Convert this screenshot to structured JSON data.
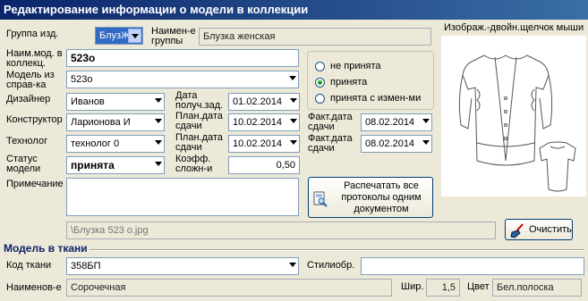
{
  "window": {
    "title": "Редактирование информации о модели в коллекции"
  },
  "group": {
    "label": "Группа изд.",
    "code": "БлузЖен",
    "name_label": "Наимен-е группы",
    "name": "Блузка женская"
  },
  "model_name": {
    "label": "Наим.мод. в коллекц.",
    "value": "523о"
  },
  "model_ref": {
    "label": "Модель из справ-ка",
    "value": "523о"
  },
  "designer": {
    "label": "Дизайнер",
    "value": "Иванов"
  },
  "constructor": {
    "label": "Конструктор",
    "value": "Ларионова И"
  },
  "technologist": {
    "label": "Технолог",
    "value": "технолог 0"
  },
  "status": {
    "label": "Статус модели",
    "value": "принята"
  },
  "date_received": {
    "label": "Дата получ.зад.",
    "value": "01.02.2014"
  },
  "plan_date_1": {
    "label": "План.дата сдачи",
    "value": "10.02.2014"
  },
  "plan_date_2": {
    "label": "План.дата сдачи",
    "value": "10.02.2014"
  },
  "complexity": {
    "label": "Коэфф. сложн-и",
    "value": "0,50"
  },
  "fact_date_1": {
    "label": "Факт.дата сдачи",
    "value": "08.02.2014"
  },
  "fact_date_2": {
    "label": "Факт.дата сдачи",
    "value": "08.02.2014"
  },
  "acceptance": {
    "options": [
      "не принята",
      "принята",
      "принята с измен-ми"
    ],
    "selected": 1
  },
  "note": {
    "label": "Примечание",
    "value": ""
  },
  "print_button": {
    "label": "Распечатать все протоколы одним документом"
  },
  "image": {
    "caption": "Изображ.-двойн.щелчок мыши"
  },
  "image_path": {
    "value": "\\Блузка 523 о.jpg"
  },
  "clear_button": {
    "label": "Очистить"
  },
  "fabric_section": {
    "title": "Модель в ткани",
    "code_label": "Код ткани",
    "code": "358БП",
    "stylist_label": "Стилиобр.",
    "stylist": "",
    "name_label": "Наименов-е",
    "name": "Сорочечная",
    "width_label": "Шир.",
    "width": "1,5",
    "color_label": "Цвет",
    "color": "Бел.полоска"
  },
  "colors": {
    "title_start": "#0a246a",
    "title_end": "#3a6ea5",
    "section_title": "#0a246a",
    "radio_dot": "#21a121"
  }
}
